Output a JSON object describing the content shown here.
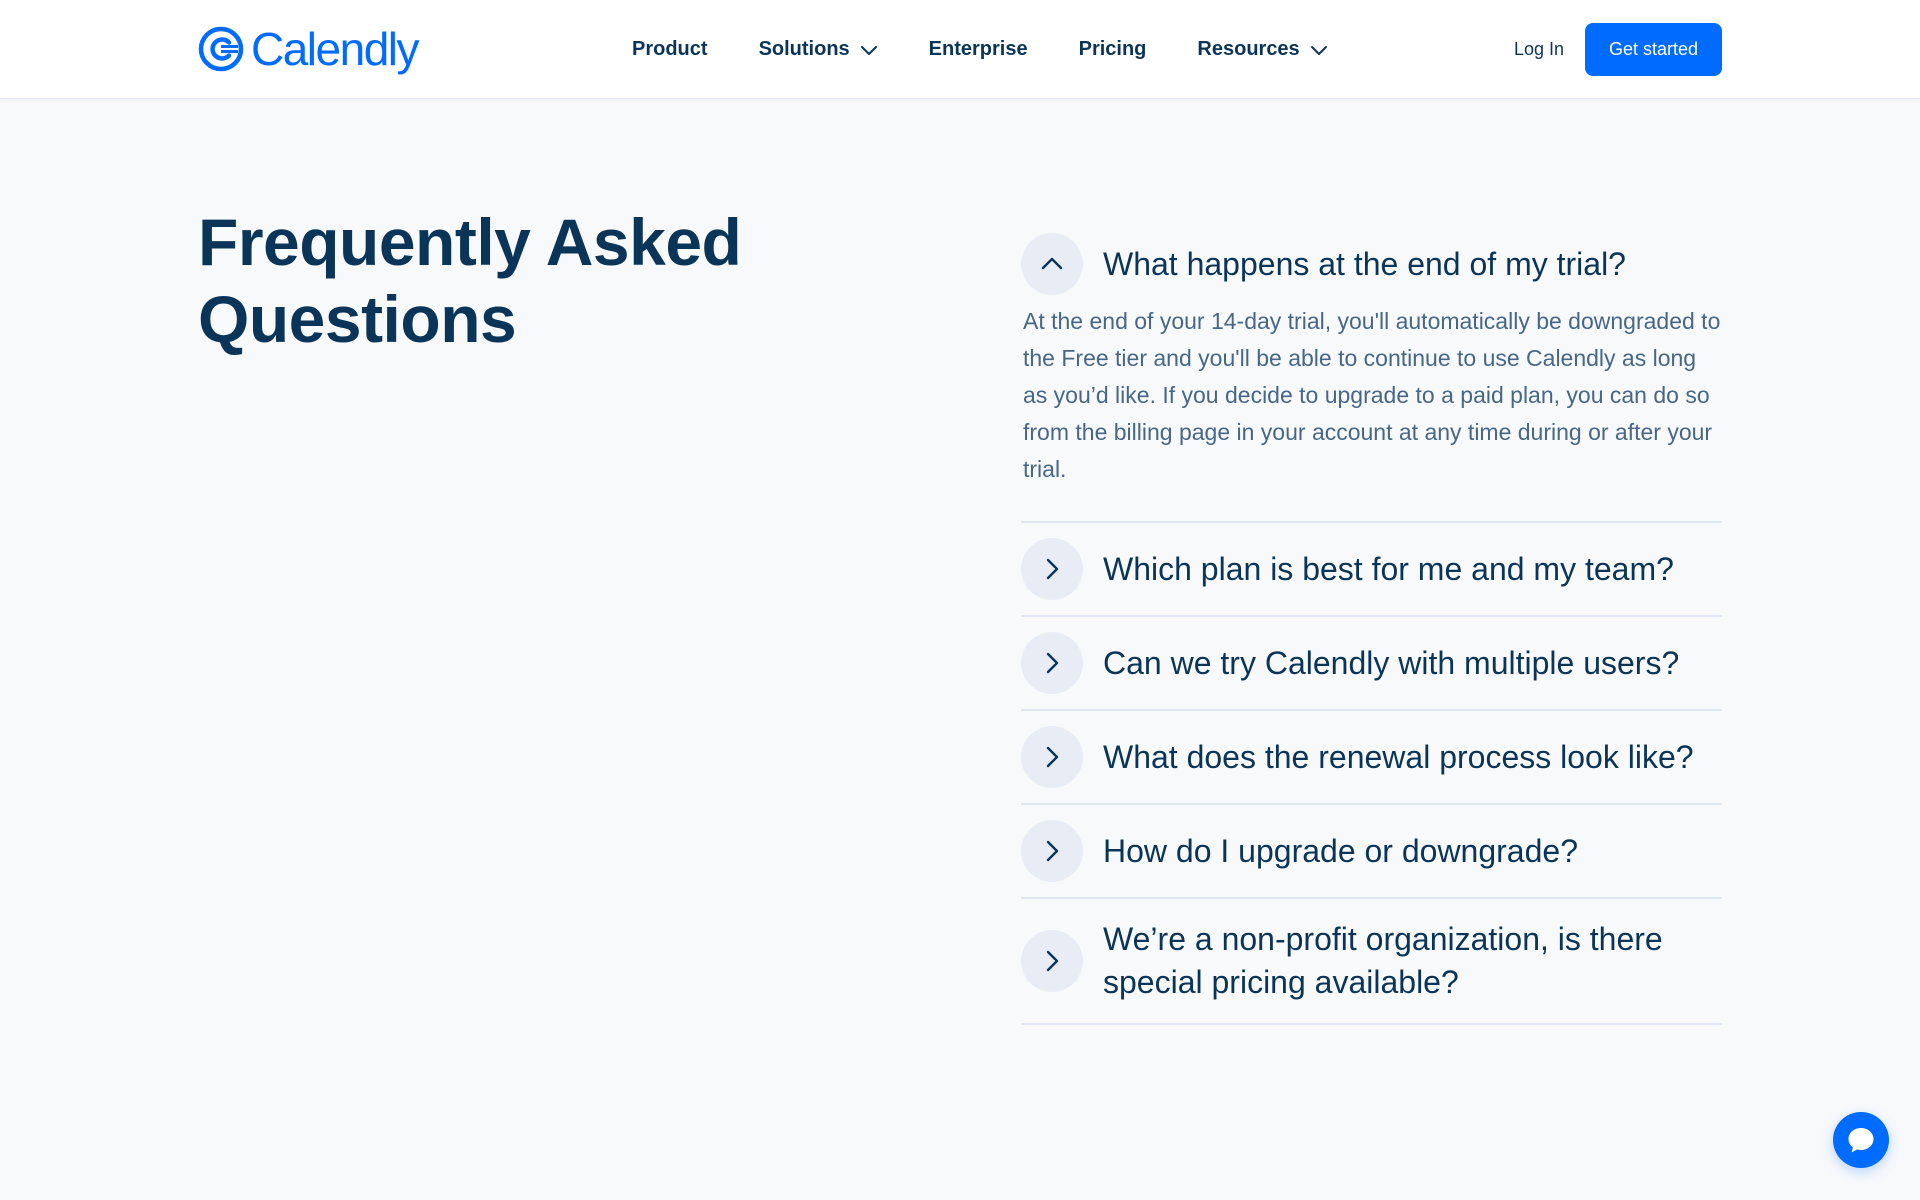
{
  "header": {
    "logo_text": "Calendly",
    "nav": [
      {
        "label": "Product",
        "has_dropdown": false
      },
      {
        "label": "Solutions",
        "has_dropdown": true
      },
      {
        "label": "Enterprise",
        "has_dropdown": false
      },
      {
        "label": "Pricing",
        "has_dropdown": false
      },
      {
        "label": "Resources",
        "has_dropdown": true
      }
    ],
    "login_label": "Log In",
    "cta_label": "Get started"
  },
  "faq": {
    "title": "Frequently Asked Questions",
    "items": [
      {
        "question": "What happens at the end of my trial?",
        "expanded": true,
        "answer": "At the end of your 14-day trial, you'll automatically be downgraded to the Free tier and you'll be able to continue to use Calendly as long as you’d like. If you decide to upgrade to a paid plan, you can do so from the billing page in your account at any time during or after your trial."
      },
      {
        "question": "Which plan is best for me and my team?",
        "expanded": false
      },
      {
        "question": "Can we try Calendly with multiple users?",
        "expanded": false
      },
      {
        "question": "What does the renewal process look like?",
        "expanded": false
      },
      {
        "question": "How do I upgrade or downgrade?",
        "expanded": false
      },
      {
        "question": "We’re a non-profit organization, is there special pricing available?",
        "expanded": false
      }
    ]
  },
  "colors": {
    "brand": "#006bff",
    "heading": "#0b3558",
    "body_text": "#476788",
    "page_bg": "#f8f9fb",
    "toggle_bg": "#e8edf5",
    "divider": "#dfe7f2"
  },
  "icons": {
    "logo": "calendly-logo-icon",
    "dropdown": "chevron-down-icon",
    "expanded": "chevron-up-icon",
    "collapsed": "chevron-right-icon",
    "chat": "chat-bubble-icon"
  }
}
